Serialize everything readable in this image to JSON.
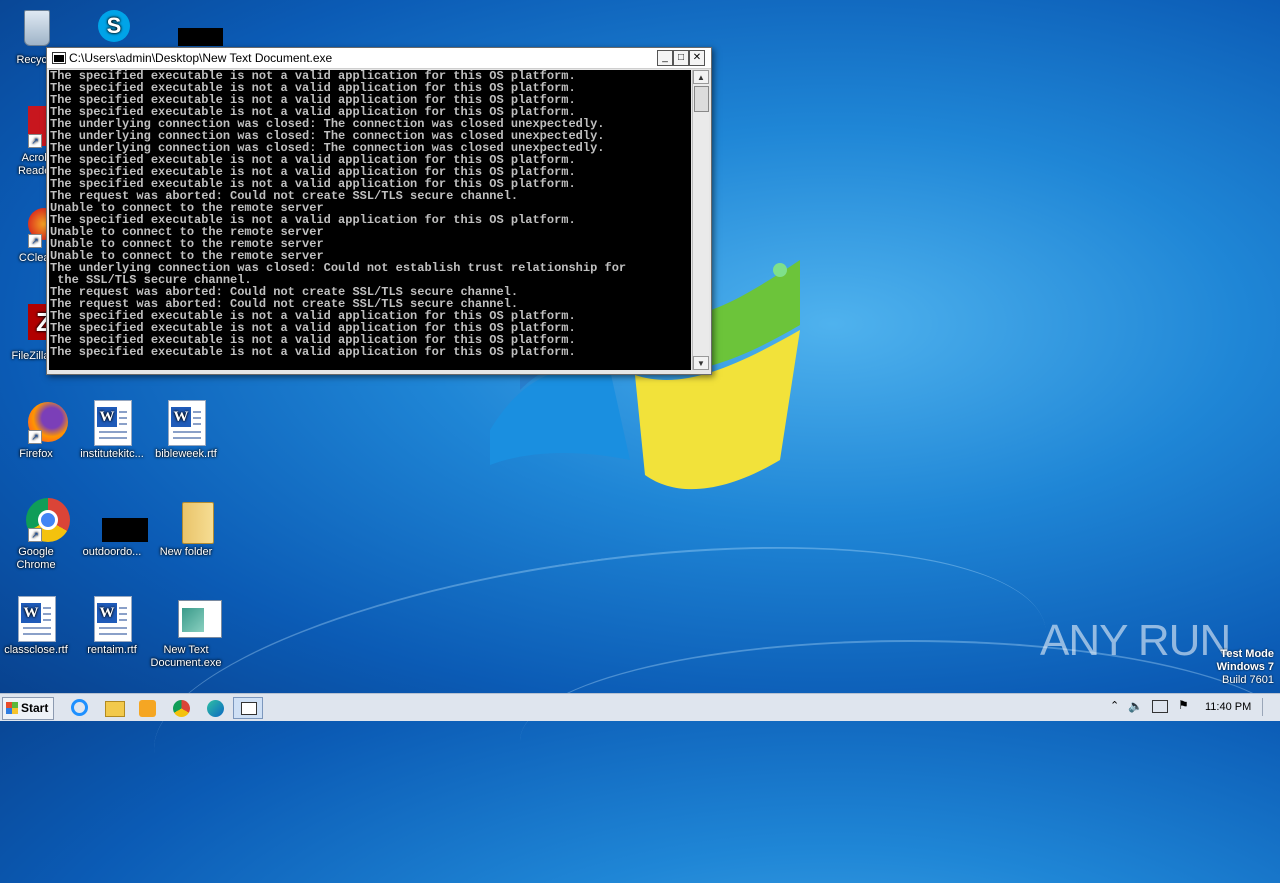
{
  "desktop": {
    "icons": [
      {
        "label": "Recycle",
        "icon": "recycle-bin-icon"
      },
      {
        "label": "",
        "icon": "skype-icon"
      },
      {
        "label": "",
        "icon": "redacted-file-icon"
      },
      {
        "label": "Acrob\nReader",
        "icon": "acrobat-reader-icon"
      },
      {
        "label": "CClear",
        "icon": "ccleaner-icon"
      },
      {
        "label": "FileZilla C",
        "icon": "filezilla-icon"
      },
      {
        "label": "Firefox",
        "icon": "firefox-icon"
      },
      {
        "label": "institutekitc...",
        "icon": "word-document-icon"
      },
      {
        "label": "bibleweek.rtf",
        "icon": "word-document-icon"
      },
      {
        "label": "Google\nChrome",
        "icon": "chrome-icon"
      },
      {
        "label": "outdoordo...",
        "icon": "redacted-file-icon"
      },
      {
        "label": "New folder",
        "icon": "folder-icon"
      },
      {
        "label": "classclose.rtf",
        "icon": "word-document-icon"
      },
      {
        "label": "rentaim.rtf",
        "icon": "word-document-icon"
      },
      {
        "label": "New Text\nDocument.exe",
        "icon": "exe-window-icon"
      }
    ]
  },
  "console": {
    "title": "C:\\Users\\admin\\Desktop\\New Text Document.exe",
    "lines": [
      "The specified executable is not a valid application for this OS platform.",
      "The specified executable is not a valid application for this OS platform.",
      "The specified executable is not a valid application for this OS platform.",
      "The specified executable is not a valid application for this OS platform.",
      "The underlying connection was closed: The connection was closed unexpectedly.",
      "The underlying connection was closed: The connection was closed unexpectedly.",
      "The underlying connection was closed: The connection was closed unexpectedly.",
      "The specified executable is not a valid application for this OS platform.",
      "The specified executable is not a valid application for this OS platform.",
      "The specified executable is not a valid application for this OS platform.",
      "The request was aborted: Could not create SSL/TLS secure channel.",
      "Unable to connect to the remote server",
      "The specified executable is not a valid application for this OS platform.",
      "Unable to connect to the remote server",
      "Unable to connect to the remote server",
      "Unable to connect to the remote server",
      "The underlying connection was closed: Could not establish trust relationship for",
      " the SSL/TLS secure channel.",
      "The request was aborted: Could not create SSL/TLS secure channel.",
      "The request was aborted: Could not create SSL/TLS secure channel.",
      "The specified executable is not a valid application for this OS platform.",
      "The specified executable is not a valid application for this OS platform.",
      "The specified executable is not a valid application for this OS platform.",
      "The specified executable is not a valid application for this OS platform."
    ]
  },
  "taskbar": {
    "start_label": "Start",
    "apps": [
      "ie-icon",
      "explorer-icon",
      "media-player-icon",
      "chrome-icon",
      "edge-icon",
      "console-window-icon"
    ],
    "clock": "11:40 PM"
  },
  "watermark": "ANY RUN",
  "testmode": {
    "line1": "Test Mode",
    "line2": "Windows 7",
    "line3": "Build 7601"
  }
}
